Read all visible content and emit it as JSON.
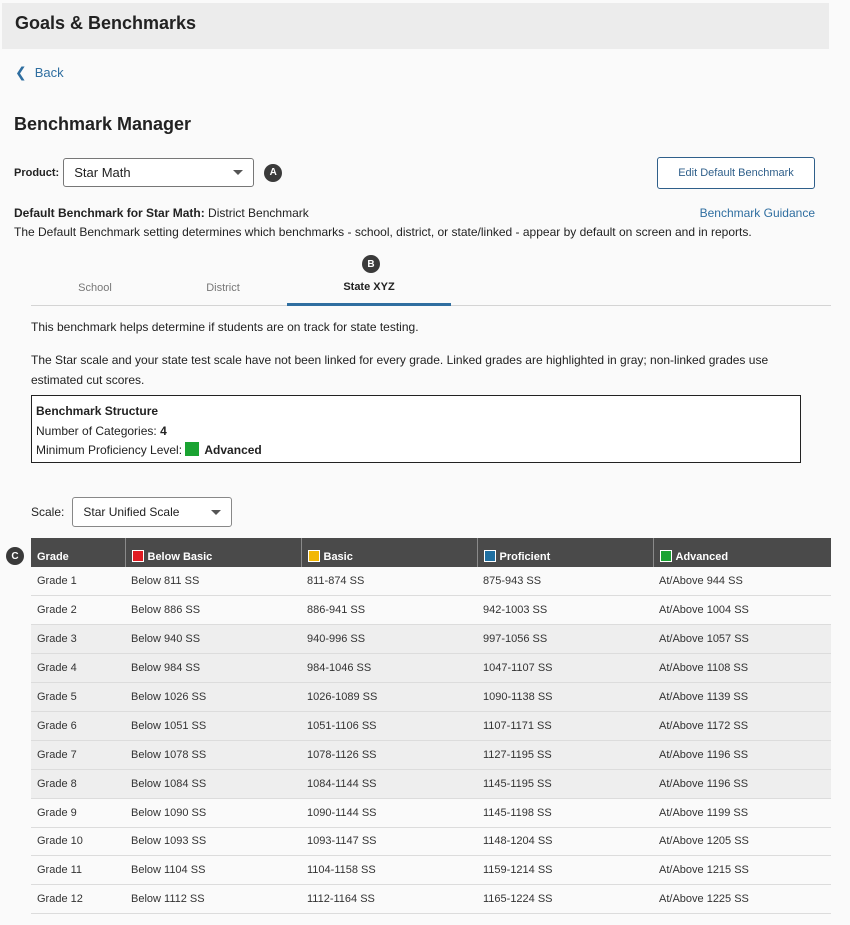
{
  "header": {
    "title": "Goals & Benchmarks"
  },
  "nav": {
    "back_label": "Back"
  },
  "page": {
    "title": "Benchmark Manager"
  },
  "product": {
    "label": "Product:",
    "selected": "Star Math",
    "marker": "A"
  },
  "edit_button": {
    "label": "Edit Default Benchmark"
  },
  "default_benchmark": {
    "label": "Default Benchmark for Star Math:",
    "value": "District Benchmark",
    "guidance_link": "Benchmark Guidance",
    "description": "The Default Benchmark setting determines which benchmarks - school, district, or state/linked - appear by default on screen and in reports."
  },
  "tabs": {
    "marker": "B",
    "items": [
      {
        "label": "School"
      },
      {
        "label": "District"
      },
      {
        "label": "State XYZ"
      }
    ]
  },
  "info": {
    "line1": "This benchmark helps determine if students are on track for state testing.",
    "line2": "The Star scale and your state test scale have not been linked for every grade. Linked grades are highlighted in gray; non-linked grades use estimated cut scores."
  },
  "structure": {
    "title": "Benchmark Structure",
    "categories_label": "Number of Categories:",
    "categories_value": "4",
    "min_level_label": "Minimum Proficiency Level:",
    "min_level_value": "Advanced"
  },
  "scale": {
    "label": "Scale:",
    "selected": "Star Unified Scale"
  },
  "table": {
    "marker": "C",
    "headers": [
      "Grade",
      "Below Basic",
      "Basic",
      "Proficient",
      "Advanced"
    ],
    "colors": {
      "below_basic": "#e01b22",
      "basic": "#f2b705",
      "proficient": "#1f6fa0",
      "advanced": "#1aa332"
    },
    "rows": [
      [
        "Grade 1",
        "Below 811 SS",
        "811-874 SS",
        "875-943 SS",
        "At/Above 944 SS"
      ],
      [
        "Grade 2",
        "Below 886 SS",
        "886-941 SS",
        "942-1003 SS",
        "At/Above 1004 SS"
      ],
      [
        "Grade 3",
        "Below 940 SS",
        "940-996 SS",
        "997-1056 SS",
        "At/Above 1057 SS"
      ],
      [
        "Grade 4",
        "Below 984 SS",
        "984-1046 SS",
        "1047-1107 SS",
        "At/Above 1108 SS"
      ],
      [
        "Grade 5",
        "Below 1026 SS",
        "1026-1089 SS",
        "1090-1138 SS",
        "At/Above 1139 SS"
      ],
      [
        "Grade 6",
        "Below 1051 SS",
        "1051-1106 SS",
        "1107-1171 SS",
        "At/Above 1172 SS"
      ],
      [
        "Grade 7",
        "Below 1078 SS",
        "1078-1126 SS",
        "1127-1195 SS",
        "At/Above 1196 SS"
      ],
      [
        "Grade 8",
        "Below 1084 SS",
        "1084-1144 SS",
        "1145-1195 SS",
        "At/Above 1196 SS"
      ],
      [
        "Grade 9",
        "Below 1090 SS",
        "1090-1144 SS",
        "1145-1198 SS",
        "At/Above 1199 SS"
      ],
      [
        "Grade 10",
        "Below 1093 SS",
        "1093-1147 SS",
        "1148-1204 SS",
        "At/Above 1205 SS"
      ],
      [
        "Grade 11",
        "Below 1104 SS",
        "1104-1158 SS",
        "1159-1214 SS",
        "At/Above 1215 SS"
      ],
      [
        "Grade 12",
        "Below 1112 SS",
        "1112-1164 SS",
        "1165-1224 SS",
        "At/Above 1225 SS"
      ]
    ]
  }
}
